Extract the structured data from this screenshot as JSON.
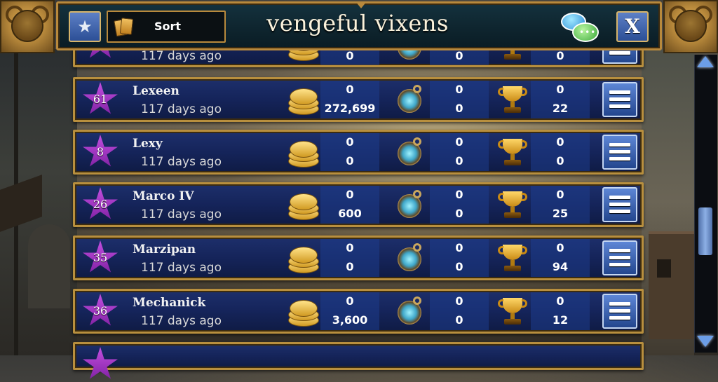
{
  "header": {
    "title": "vengeful vixens",
    "sort_label": "Sort",
    "close_label": "X",
    "rank_icon": "star-medal-icon",
    "chat_icon": "chat-bubbles-icon"
  },
  "partial_top": {
    "seen": "117 days ago",
    "gold_top": "0",
    "gems_top": "0",
    "trophies_top": "0"
  },
  "members": [
    {
      "level": "61",
      "name": "Lexeen",
      "seen": "117 days ago",
      "gold_top": "0",
      "gold_bottom": "272,699",
      "gems_top": "0",
      "gems_bottom": "0",
      "trophies_top": "0",
      "trophies_bottom": "22"
    },
    {
      "level": "8",
      "name": "Lexy",
      "seen": "117 days ago",
      "gold_top": "0",
      "gold_bottom": "0",
      "gems_top": "0",
      "gems_bottom": "0",
      "trophies_top": "0",
      "trophies_bottom": "0"
    },
    {
      "level": "26",
      "name": "Marco IV",
      "seen": "117 days ago",
      "gold_top": "0",
      "gold_bottom": "600",
      "gems_top": "0",
      "gems_bottom": "0",
      "trophies_top": "0",
      "trophies_bottom": "25"
    },
    {
      "level": "35",
      "name": "Marzipan",
      "seen": "117 days ago",
      "gold_top": "0",
      "gold_bottom": "0",
      "gems_top": "0",
      "gems_bottom": "0",
      "trophies_top": "0",
      "trophies_bottom": "94"
    },
    {
      "level": "36",
      "name": "Mechanick",
      "seen": "117 days ago",
      "gold_top": "0",
      "gold_bottom": "3,600",
      "gems_top": "0",
      "gems_bottom": "0",
      "trophies_top": "0",
      "trophies_bottom": "12"
    }
  ],
  "colors": {
    "row_border": "#b88f3e",
    "row_fill": "#15245a",
    "level_star": "#a23cc8",
    "button_blue": "#2c4f96"
  }
}
